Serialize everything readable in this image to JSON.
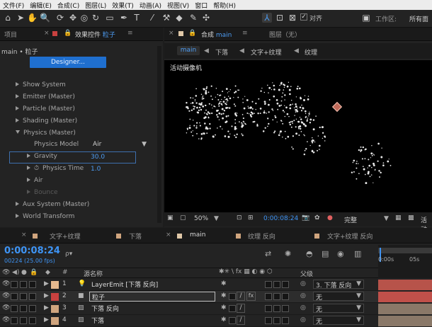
{
  "menu": [
    "文件(F)",
    "编辑(E)",
    "合成(C)",
    "图层(L)",
    "效果(T)",
    "动画(A)",
    "视图(V)",
    "窗口",
    "帮助(H)"
  ],
  "toolbar": {
    "align_label": "对齐",
    "workspace_label": "工作区:",
    "workspace_value": "所有面"
  },
  "left_tabs": {
    "project": "项目",
    "effects_prefix": "效果控件",
    "effects_layer": "粒子"
  },
  "breadcrumb": "main • 粒子",
  "designer_button": "Designer...",
  "effect_rows": [
    {
      "label": "Show System",
      "indent": 1,
      "open": false
    },
    {
      "label": "Emitter (Master)",
      "indent": 1,
      "open": false
    },
    {
      "label": "Particle (Master)",
      "indent": 1,
      "open": false
    },
    {
      "label": "Shading (Master)",
      "indent": 1,
      "open": false
    },
    {
      "label": "Physics (Master)",
      "indent": 1,
      "open": true
    }
  ],
  "physics": {
    "model_label": "Physics Model",
    "model_value": "Air",
    "gravity_label": "Gravity",
    "gravity_value": "30.0",
    "time_label": "Physics Time",
    "time_value": "1.0",
    "air_label": "Air",
    "bounce_label": "Bounce"
  },
  "effect_rows_tail": [
    {
      "label": "Aux System (Master)"
    },
    {
      "label": "World Transform"
    }
  ],
  "comp_tabs": {
    "comp_prefix": "合成",
    "comp_name": "main",
    "layer_tab": "图层（无）"
  },
  "comp_breadcrumb": [
    "main",
    "下落",
    "文字+纹理",
    "纹理"
  ],
  "camera_label": "活动摄像机",
  "viewer_footer": {
    "zoom": "50%",
    "time": "0:00:08:24",
    "quality": "完整",
    "camera": "活动"
  },
  "timeline_tabs": [
    "文字+纹理",
    "下落",
    "main",
    "纹理 反向",
    "文字+纹理 反向"
  ],
  "timecode": "0:00:08:24",
  "frame_info": "00224 (25.00 fps)",
  "search_placeholder": "ρ▾",
  "col_headers": {
    "hash": "#",
    "source": "源名称",
    "parent": "父级"
  },
  "ruler": {
    "t0": "0:00s",
    "t1": "05s"
  },
  "layers": [
    {
      "num": "1",
      "name": "LayerEmit [下落 反向]",
      "color": "#e6b98e",
      "parent": "3. 下落 反向",
      "bar": "#b7534a"
    },
    {
      "num": "2",
      "name": "粒子",
      "color": "#c8413f",
      "parent": "无",
      "bar": "#c0504a"
    },
    {
      "num": "3",
      "name": "下落 反向",
      "color": "#d0a57e",
      "parent": "无",
      "bar": "#8a7868"
    },
    {
      "num": "4",
      "name": "下落",
      "color": "#d0a57e",
      "parent": "无",
      "bar": "#8a7868"
    }
  ],
  "colors": {
    "accent": "#4d9cf3",
    "time_blue": "#3e94f5",
    "designer": "#1f6fcf"
  }
}
